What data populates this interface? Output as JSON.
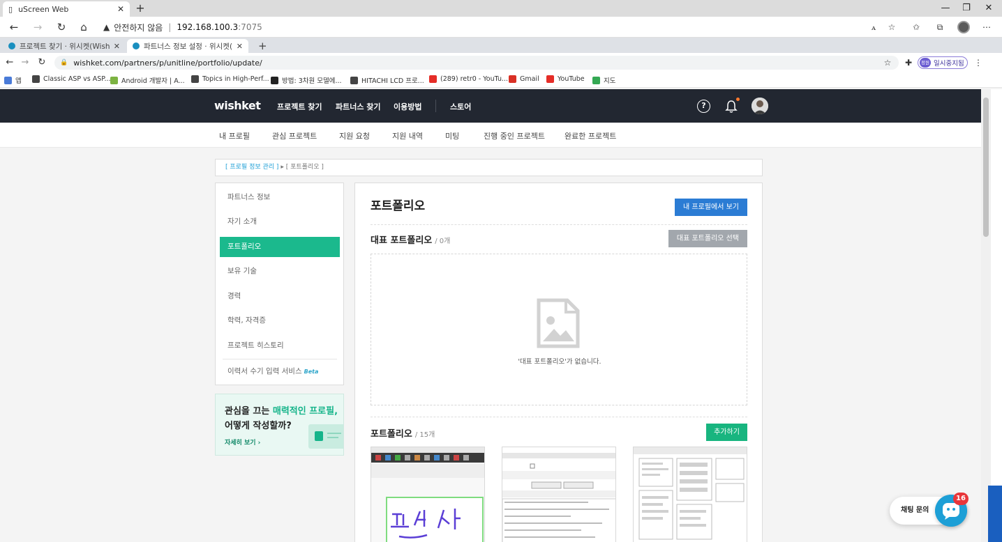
{
  "outer_browser": {
    "tab_title": "uScreen Web",
    "address_warning": "안전하지 않음",
    "address_host": "192.168.100.3",
    "address_port": ":7075"
  },
  "inner_browser": {
    "tabs": [
      {
        "title": "프로젝트 찾기 · 위시켓(Wishket)",
        "active": false
      },
      {
        "title": "파트너스 정보 설정 · 위시켓(Wis",
        "active": true
      }
    ],
    "url": "wishket.com/partners/p/unitline/portfolio/update/",
    "pause_badge": "정원",
    "pause_label": "일시중지됨"
  },
  "bookmarks": [
    {
      "label": "앱",
      "color": "#4a7bd8"
    },
    {
      "label": "Classic ASP vs ASP....",
      "color": "#444444"
    },
    {
      "label": "Android 개발자 | A...",
      "color": "#7cb342"
    },
    {
      "label": "Topics in High-Perf...",
      "color": "#444444"
    },
    {
      "label": "방법: 3차원 모델에...",
      "color": "#222222"
    },
    {
      "label": "HITACHI LCD 프로...",
      "color": "#444444"
    },
    {
      "label": "(289) retr0 - YouTu...",
      "color": "#e52d27"
    },
    {
      "label": "Gmail",
      "color": "#d93025"
    },
    {
      "label": "YouTube",
      "color": "#e52d27"
    },
    {
      "label": "지도",
      "color": "#34a853"
    }
  ],
  "gnb": {
    "logo": "wishket",
    "links": [
      "프로젝트 찾기",
      "파트너스 찾기",
      "이용방법",
      "스토어"
    ],
    "help": "?"
  },
  "lnb": {
    "links": [
      "내 프로필",
      "관심 프로젝트",
      "지원 요청",
      "지원 내역",
      "미팅",
      "진행 중인 프로젝트",
      "완료한 프로젝트"
    ]
  },
  "breadcrumb": {
    "level1": "[ 프로필 정보 관리 ]",
    "arrow": "▸",
    "level2": "[ 포트폴리오 ]"
  },
  "sidebar": {
    "items": [
      "파트너스 정보",
      "자기 소개",
      "포트폴리오",
      "보유 기술",
      "경력",
      "학력, 자격증",
      "프로젝트 히스토리"
    ],
    "active_index": 2,
    "resume_item": "이력서 수기 입력 서비스",
    "beta": "Beta"
  },
  "promo": {
    "line1_a": "관심을 끄는 ",
    "line1_b": "매력적인 프로필,",
    "line2": "어떻게 작성할까?",
    "more": "자세히 보기 ›"
  },
  "content": {
    "title": "포트폴리오",
    "view_profile_btn": "내 프로필에서 보기",
    "featured_title": "대표 포트폴리오",
    "featured_count": "/ 0개",
    "featured_select_btn": "대표 포트폴리오 선택",
    "empty_text": "'대표 포트폴리오'가 없습니다.",
    "portfolio_title": "포트폴리오",
    "portfolio_count": "/ 15개",
    "add_btn": "추가하기"
  },
  "chat": {
    "label": "채팅 문의",
    "badge": "16"
  },
  "colors": {
    "gnb_bg": "#222731",
    "accent_green": "#1bb98d",
    "button_blue": "#2b7cd4",
    "button_gray": "#a2a7ad",
    "chat_blue": "#1d9fd6",
    "badge_red": "#e8363a"
  }
}
